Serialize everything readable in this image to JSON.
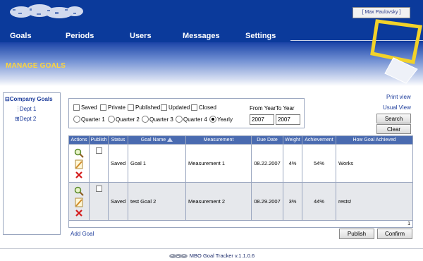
{
  "header": {
    "user_name": "[ Max Paulovsky ]"
  },
  "nav": {
    "items": [
      {
        "label": "Goals"
      },
      {
        "label": "Periods"
      },
      {
        "label": "Users"
      },
      {
        "label": "Messages"
      },
      {
        "label": "Settings"
      }
    ]
  },
  "page": {
    "title": "MANAGE GOALS"
  },
  "tree": {
    "root_label": "Company Goals",
    "children": [
      {
        "label": "Dept 1"
      },
      {
        "label": "Dept 2"
      }
    ]
  },
  "filters": {
    "checkboxes": [
      {
        "label": "Saved",
        "checked": false
      },
      {
        "label": "Private",
        "checked": false
      },
      {
        "label": "Published",
        "checked": false
      },
      {
        "label": "Updated",
        "checked": false
      },
      {
        "label": "Closed",
        "checked": false
      }
    ],
    "periods": [
      {
        "label": "Quarter 1",
        "selected": false
      },
      {
        "label": "Quarter 2",
        "selected": false
      },
      {
        "label": "Quarter 3",
        "selected": false
      },
      {
        "label": "Quarter 4",
        "selected": false
      },
      {
        "label": "Yearly",
        "selected": true
      }
    ],
    "year_label": "From YearTo Year",
    "from_year": "2007",
    "to_year": "2007"
  },
  "links": {
    "print_view": "Print view",
    "usual_view": "Usual View",
    "add_goal": "Add Goal"
  },
  "buttons": {
    "search": "Search",
    "clear": "Clear",
    "publish": "Publish",
    "confirm": "Confirm"
  },
  "table": {
    "columns": [
      "Actions",
      "Publish",
      "Status",
      "Goal Name",
      "Measurement",
      "Due Date",
      "Weight",
      "Achievement",
      "How Goal Achieved"
    ],
    "rows": [
      {
        "status": "Saved",
        "goal_name": "Goal 1",
        "measurement": "Measurement 1",
        "due_date": "08.22.2007",
        "weight": "4%",
        "achievement": "54%",
        "how_achieved": "Works"
      },
      {
        "status": "Saved",
        "goal_name": "test Goal 2",
        "measurement": "Measurement 2",
        "due_date": "08.29.2007",
        "weight": "3%",
        "achievement": "44%",
        "how_achieved": "rests!"
      }
    ],
    "page_number": "1"
  },
  "footer": {
    "text": "MBO Goal Tracker v.1.1.0.6"
  },
  "colors": {
    "header_blue": "#0b3a9b",
    "title_yellow": "#ffd53a",
    "table_header": "#4a6bb0",
    "link_blue": "#1a3a9a"
  }
}
